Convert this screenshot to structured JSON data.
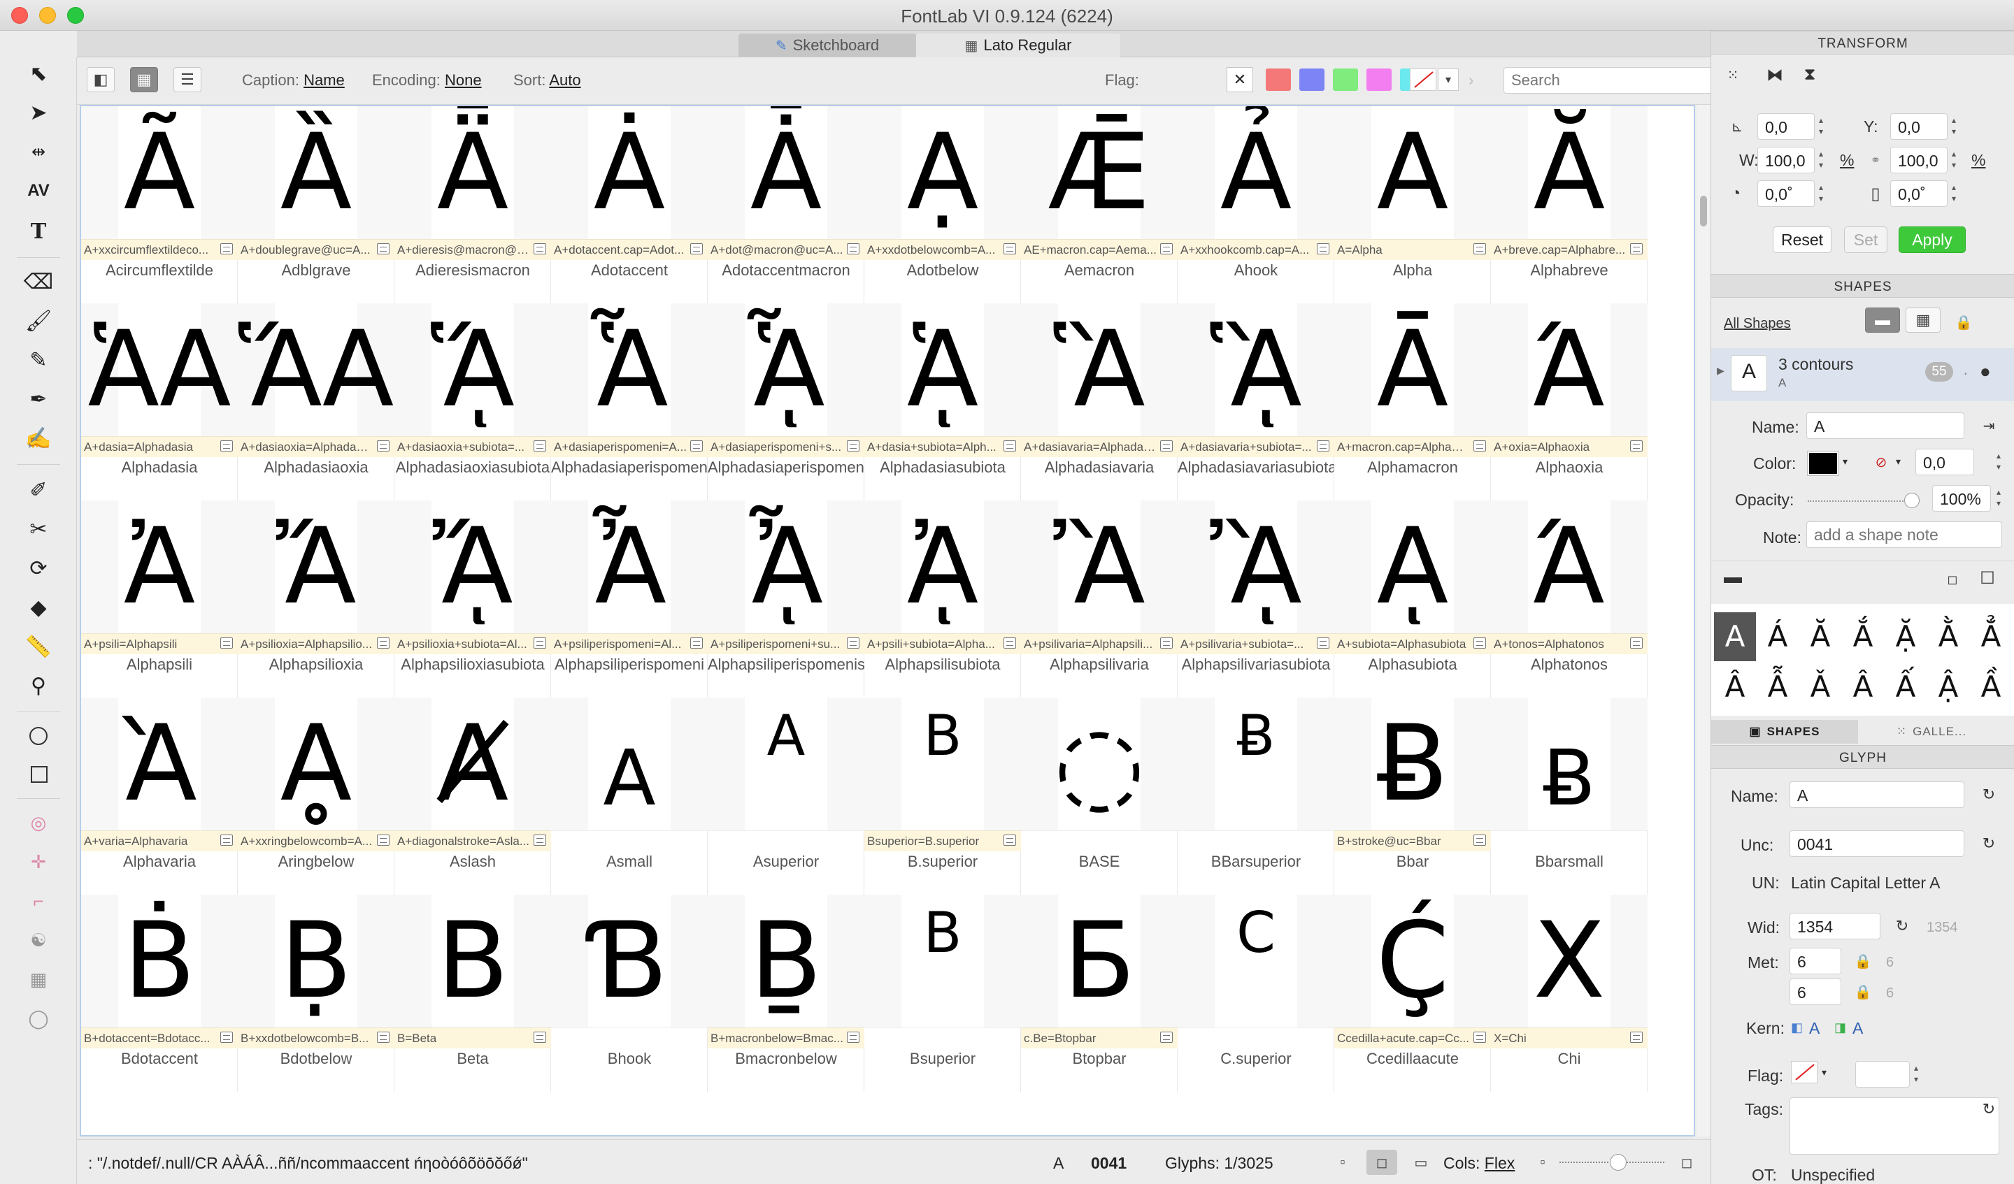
{
  "window": {
    "title": "FontLab VI 0.9.124 (6224)"
  },
  "tabs": [
    {
      "label": "Sketchboard",
      "icon": "pen-icon"
    },
    {
      "label": "Lato Regular",
      "icon": "grid-icon"
    }
  ],
  "canvas_toolbar": {
    "caption_label": "Caption:",
    "caption_value": "Name",
    "encoding_label": "Encoding:",
    "encoding_value": "None",
    "sort_label": "Sort:",
    "sort_value": "Auto",
    "flag_label": "Flag:",
    "flag_clear": "✕",
    "flag_colors": [
      "#f47878",
      "#7d84f5",
      "#7fec7d",
      "#f27ef0",
      "#6ce8ef"
    ],
    "search_placeholder": "Search"
  },
  "glyph_rows": [
    [
      {
        "glyph": "Ã",
        "name": "Acircumflextilde",
        "rec": "A+xxcircumflextildeco..."
      },
      {
        "glyph": "Ȁ",
        "name": "Adblgrave",
        "rec": "A+doublegrave@uc=A..."
      },
      {
        "glyph": "Ǟ",
        "name": "Adieresismacron",
        "rec": "A+dieresis@macron@u..."
      },
      {
        "glyph": "Ȧ",
        "name": "Adotaccent",
        "rec": "A+dotaccent.cap=Adot..."
      },
      {
        "glyph": "Ǡ",
        "name": "Adotaccentmacron",
        "rec": "A+dot@macron@uc=A..."
      },
      {
        "glyph": "Ạ",
        "name": "Adotbelow",
        "rec": "A+xxdotbelowcomb=A..."
      },
      {
        "glyph": "Ǣ",
        "name": "Aemacron",
        "rec": "AE+macron.cap=Aema..."
      },
      {
        "glyph": "Ả",
        "name": "Ahook",
        "rec": "A+xxhookcomb.cap=A..."
      },
      {
        "glyph": "A",
        "name": "Alpha",
        "rec": "A=Alpha"
      },
      {
        "glyph": "Ă",
        "name": "Alphabreve",
        "rec": "A+breve.cap=Alphabre..."
      }
    ],
    [
      {
        "glyph": "ἉA",
        "name": "Alphadasia",
        "rec": "A+dasia=Alphadasia"
      },
      {
        "glyph": "ἍA",
        "name": "Alphadasiaoxia",
        "rec": "A+dasiaoxia=Alphadasi..."
      },
      {
        "glyph": "ᾍ",
        "name": "Alphadasiaoxiasubiota",
        "rec": "A+dasiaoxia+subiota=..."
      },
      {
        "glyph": "Ἇ",
        "name": "Alphadasiaperispomeni",
        "rec": "A+dasiaperispomeni=A..."
      },
      {
        "glyph": "ᾏ",
        "name": "Alphadasiaperispomenisubiota",
        "rec": "A+dasiaperispomeni+s..."
      },
      {
        "glyph": "ᾉ",
        "name": "Alphadasiasubiota",
        "rec": "A+dasia+subiota=Alph..."
      },
      {
        "glyph": "Ἃ",
        "name": "Alphadasiavaria",
        "rec": "A+dasiavaria=Alphadas..."
      },
      {
        "glyph": "ᾋ",
        "name": "Alphadasiavariasubiota",
        "rec": "A+dasiavaria+subiota=..."
      },
      {
        "glyph": "Ᾱ",
        "name": "Alphamacron",
        "rec": "A+macron.cap=Alpham..."
      },
      {
        "glyph": "Ά",
        "name": "Alphaoxia",
        "rec": "A+oxia=Alphaoxia"
      }
    ],
    [
      {
        "glyph": "Ἀ",
        "name": "Alphapsili",
        "rec": "A+psili=Alphapsili"
      },
      {
        "glyph": "Ἄ",
        "name": "Alphapsilioxia",
        "rec": "A+psilioxia=Alphapsilio..."
      },
      {
        "glyph": "ᾌ",
        "name": "Alphapsilioxiasubiota",
        "rec": "A+psilioxia+subiota=Al..."
      },
      {
        "glyph": "Ἆ",
        "name": "Alphapsiliperispomeni",
        "rec": "A+psiliperispomeni=Al..."
      },
      {
        "glyph": "ᾎ",
        "name": "Alphapsiliperispomenisubiota",
        "rec": "A+psiliperispomeni+su..."
      },
      {
        "glyph": "ᾈ",
        "name": "Alphapsilisubiota",
        "rec": "A+psili+subiota=Alpha..."
      },
      {
        "glyph": "Ἂ",
        "name": "Alphapsilivaria",
        "rec": "A+psilivaria=Alphapsili..."
      },
      {
        "glyph": "ᾊ",
        "name": "Alphapsilivariasubiota",
        "rec": "A+psilivaria+subiota=..."
      },
      {
        "glyph": "ᾼ",
        "name": "Alphasubiota",
        "rec": "A+subiota=Alphasubiota"
      },
      {
        "glyph": "Ά",
        "name": "Alphatonos",
        "rec": "A+tonos=Alphatonos"
      }
    ],
    [
      {
        "glyph": "Ὰ",
        "name": "Alphavaria",
        "rec": "A+varia=Alphavaria"
      },
      {
        "glyph": "Ḁ",
        "name": "Aringbelow",
        "rec": "A+xxringbelowcomb=A..."
      },
      {
        "glyph": "Ⱥ",
        "name": "Aslash",
        "rec": "A+diagonalstroke=Asla..."
      },
      {
        "glyph": "A",
        "name": "Asmall",
        "rec": "",
        "size": "mid"
      },
      {
        "glyph": "A",
        "name": "Asuperior",
        "rec": "",
        "size": "small"
      },
      {
        "glyph": "B",
        "name": "B.superior",
        "rec": "Bsuperior=B.superior",
        "size": "small"
      },
      {
        "glyph": "◌",
        "name": "BASE",
        "rec": ""
      },
      {
        "glyph": "Ƀ",
        "name": "BBarsuperior",
        "rec": "",
        "size": "small"
      },
      {
        "glyph": "Ƀ",
        "name": "Bbar",
        "rec": "B+stroke@uc=Bbar"
      },
      {
        "glyph": "Ƀ",
        "name": "Bbarsmall",
        "rec": "",
        "size": "mid"
      }
    ],
    [
      {
        "glyph": "Ḃ",
        "name": "Bdotaccent",
        "rec": "B+dotaccent=Bdotacc..."
      },
      {
        "glyph": "Ḅ",
        "name": "Bdotbelow",
        "rec": "B+xxdotbelowcomb=B..."
      },
      {
        "glyph": "B",
        "name": "Beta",
        "rec": "B=Beta"
      },
      {
        "glyph": "Ɓ",
        "name": "Bhook",
        "rec": ""
      },
      {
        "glyph": "Ḇ",
        "name": "Bmacronbelow",
        "rec": "B+macronbelow=Bmac..."
      },
      {
        "glyph": "B",
        "name": "Bsuperior",
        "rec": "",
        "size": "small"
      },
      {
        "glyph": "Б",
        "name": "Btopbar",
        "rec": "c.Be=Btopbar"
      },
      {
        "glyph": "C",
        "name": "C.superior",
        "rec": "",
        "size": "small"
      },
      {
        "glyph": "Ḉ",
        "name": "Ccedillaacute",
        "rec": "Ccedilla+acute.cap=Cc..."
      },
      {
        "glyph": "X",
        "name": "Chi",
        "rec": "X=Chi"
      }
    ]
  ],
  "status": {
    "string": ": \"/.notdef/.null/CR  AÀÁÂ...ññ/ncommaaccent ńηoòóôõöōŏőǿ\"",
    "glyph_char": "A",
    "unicode": "0041",
    "glyphs_count": "Glyphs: 1/3025",
    "cols_label": "Cols:",
    "cols_value": "Flex"
  },
  "transform": {
    "header": "TRANSFORM",
    "x": "0,0",
    "y_label": "Y:",
    "y": "0,0",
    "w_label": "W:",
    "w": "100,0",
    "pct": "%",
    "h": "100,0",
    "pct2": "%",
    "rot": "0,0˚",
    "slant": "0,0˚",
    "reset": "Reset",
    "set": "Set",
    "apply": "Apply"
  },
  "shapes": {
    "header": "SHAPES",
    "all_shapes": "All Shapes",
    "row_letter": "A",
    "row_title": "3 contours",
    "row_sub": "A",
    "row_count": "55",
    "name_label": "Name:",
    "name_value": "A",
    "color_label": "Color:",
    "stroke_value": "0,0",
    "opacity_label": "Opacity:",
    "opacity_value": "100%",
    "opacity_fraction": 1.0,
    "note_label": "Note:",
    "note_placeholder": "add a shape note",
    "grid_glyphs": [
      "A",
      "Á",
      "Ă",
      "Ắ",
      "Ặ",
      "Ằ",
      "Ẳ",
      "Â",
      "Ẫ",
      "Ǎ",
      "Â",
      "Ấ",
      "Ậ",
      "Ầ"
    ],
    "tab_shapes": "SHAPES",
    "tab_gallery": "GALLE..."
  },
  "glyph_panel": {
    "header": "GLYPH",
    "name_label": "Name:",
    "name_value": "A",
    "unc_label": "Unc:",
    "unc_value": "0041",
    "un_label": "UN:",
    "un_value": "Latin Capital Letter A",
    "wid_label": "Wid:",
    "wid_value": "1354",
    "wid_hint": "1354",
    "met_label": "Met:",
    "met_left": "6",
    "met_right": "6",
    "met_hint_l": "6",
    "met_hint_r": "6",
    "kern_label": "Kern:",
    "kern_left": "A",
    "kern_right": "A",
    "flag_label": "Flag:",
    "tags_label": "Tags:",
    "ot_label": "OT:",
    "ot_value": "Unspecified"
  }
}
